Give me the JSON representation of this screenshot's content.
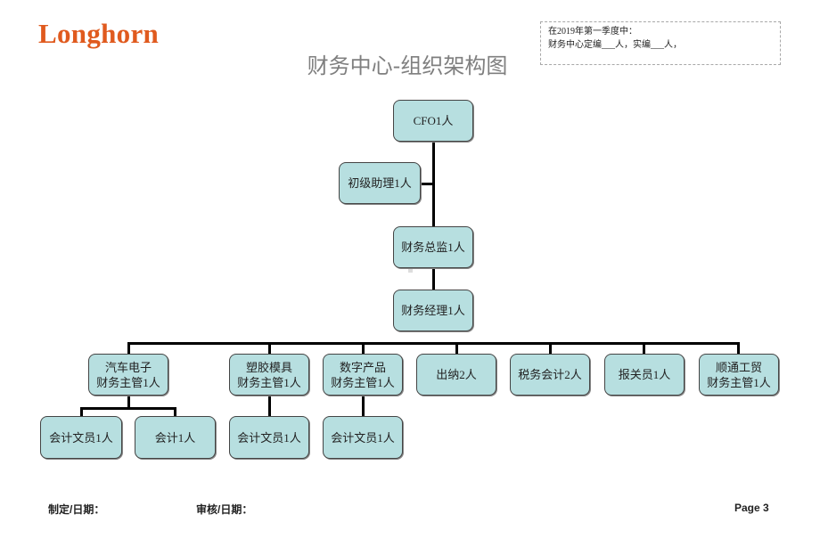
{
  "header": {
    "logo": "Longhorn",
    "title": "财务中心-组织架构图",
    "note_line1": "在2019年第一季度中：",
    "note_line2": "财务中心定编___人，实编___人，"
  },
  "org_chart": {
    "cfo": "CFO1人",
    "assistant": "初级助理1人",
    "finance_director": "财务总监1人",
    "finance_manager": "财务经理1人",
    "departments": [
      {
        "line1": "汽车电子",
        "line2": "财务主管1人"
      },
      {
        "line1": "塑胶模具",
        "line2": "财务主管1人"
      },
      {
        "line1": "数字产品",
        "line2": "财务主管1人"
      },
      {
        "line1": "出纳2人",
        "line2": ""
      },
      {
        "line1": "税务会计2人",
        "line2": ""
      },
      {
        "line1": "报关员1人",
        "line2": ""
      },
      {
        "line1": "顺通工贸",
        "line2": "财务主管1人"
      }
    ],
    "staff": [
      {
        "label": "会计文员1人",
        "parent": "汽车电子"
      },
      {
        "label": "会计1人",
        "parent": "汽车电子"
      },
      {
        "label": "会计文员1人",
        "parent": "塑胶模具"
      },
      {
        "label": "会计文员1人",
        "parent": "数字产品"
      }
    ]
  },
  "footer": {
    "prepared": "制定/日期：",
    "reviewed": "审核/日期：",
    "page": "Page 3"
  }
}
